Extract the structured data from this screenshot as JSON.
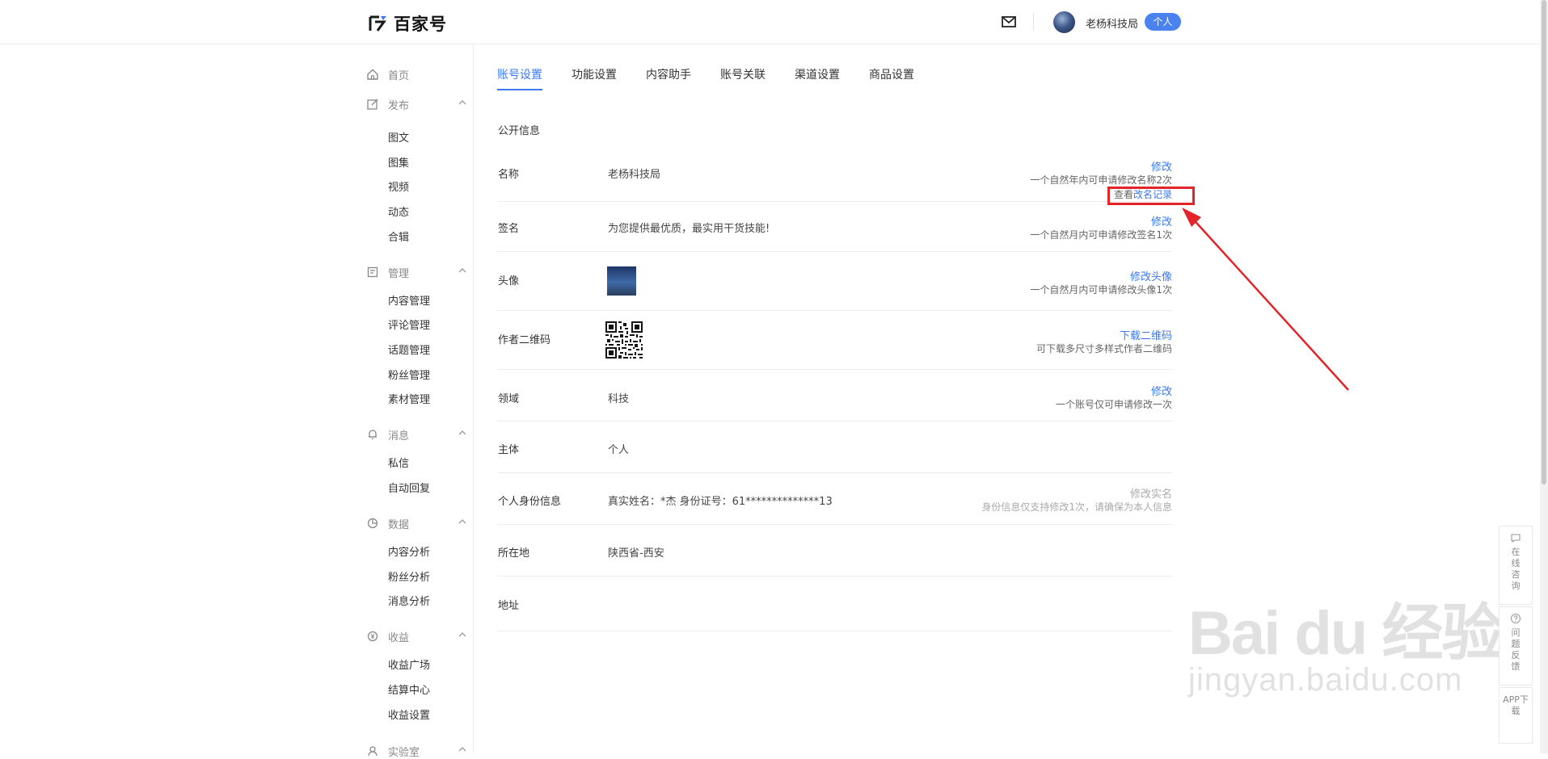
{
  "header": {
    "logo_text": "百家号",
    "username": "老杨科技局",
    "badge": "个人"
  },
  "sidebar": {
    "home": "首页",
    "groups": [
      {
        "title": "发布",
        "items": [
          "图文",
          "图集",
          "视频",
          "动态",
          "合辑"
        ]
      },
      {
        "title": "管理",
        "items": [
          "内容管理",
          "评论管理",
          "话题管理",
          "粉丝管理",
          "素材管理"
        ]
      },
      {
        "title": "消息",
        "items": [
          "私信",
          "自动回复"
        ]
      },
      {
        "title": "数据",
        "items": [
          "内容分析",
          "粉丝分析",
          "消息分析"
        ]
      },
      {
        "title": "收益",
        "items": [
          "收益广场",
          "结算中心",
          "收益设置"
        ]
      },
      {
        "title": "实验室",
        "items": []
      }
    ]
  },
  "tabs": [
    "账号设置",
    "功能设置",
    "内容助手",
    "账号关联",
    "渠道设置",
    "商品设置"
  ],
  "section_title": "公开信息",
  "rows": {
    "name": {
      "label": "名称",
      "value": "老杨科技局",
      "action": "修改",
      "hint": "一个自然年内可申请修改名称2次",
      "history_prefix": "查看",
      "history_link": "改名记录"
    },
    "signature": {
      "label": "签名",
      "value": "为您提供最优质，最实用干货技能!",
      "action": "修改",
      "hint": "一个自然月内可申请修改签名1次"
    },
    "avatar": {
      "label": "头像",
      "action": "修改头像",
      "hint": "一个自然月内可申请修改头像1次"
    },
    "qrcode": {
      "label": "作者二维码",
      "action": "下载二维码",
      "hint": "可下载多尺寸多样式作者二维码"
    },
    "domain": {
      "label": "领域",
      "value": "科技",
      "action": "修改",
      "hint": "一个账号仅可申请修改一次"
    },
    "subject": {
      "label": "主体",
      "value": "个人"
    },
    "identity": {
      "label": "个人身份信息",
      "value": "真实姓名：*杰     身份证号：61**************13",
      "action": "修改实名",
      "hint": "身份信息仅支持修改1次，请确保为本人信息"
    },
    "location": {
      "label": "所在地",
      "value": "陕西省-西安"
    },
    "address": {
      "label": "地址"
    }
  },
  "float_tools": [
    "在线咨询",
    "问题反馈",
    "APP下载"
  ],
  "watermark": {
    "brand": "Bai du 经验",
    "url": "jingyan.baidu.com"
  },
  "colors": {
    "accent": "#3b78f2",
    "badge": "#4a82f0",
    "highlight": "#e3252a"
  }
}
